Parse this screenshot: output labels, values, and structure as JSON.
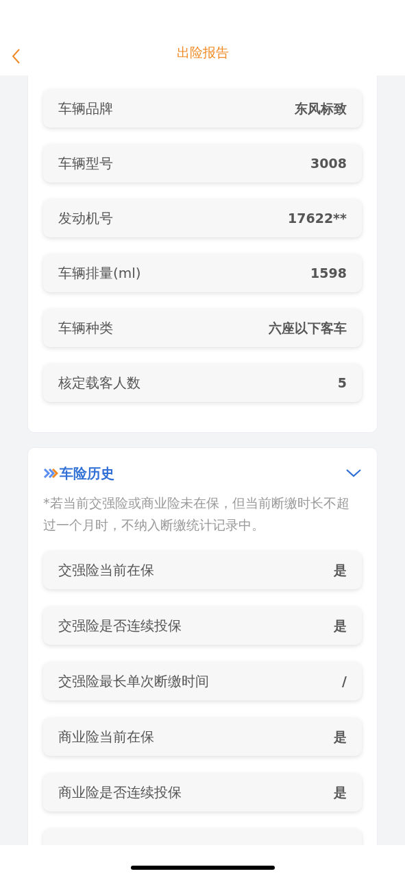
{
  "header": {
    "title": "出险报告"
  },
  "vehicle_rows": [
    {
      "label": "车辆品牌",
      "value": "东风标致"
    },
    {
      "label": "车辆型号",
      "value": "3008"
    },
    {
      "label": "发动机号",
      "value": "17622**"
    },
    {
      "label": "车辆排量(ml)",
      "value": "1598"
    },
    {
      "label": "车辆种类",
      "value": "六座以下客车"
    },
    {
      "label": "核定载客人数",
      "value": "5"
    }
  ],
  "history": {
    "title": "车险历史",
    "expanded": true,
    "note": "*若当前交强险或商业险未在保，但当前断缴时长不超过一个月时，不纳入断缴统计记录中。",
    "rows": [
      {
        "label": "交强险当前在保",
        "value": "是"
      },
      {
        "label": "交强险是否连续投保",
        "value": "是"
      },
      {
        "label": "交强险最长单次断缴时间",
        "value": "/"
      },
      {
        "label": "商业险当前在保",
        "value": "是"
      },
      {
        "label": "商业险是否连续投保",
        "value": "是"
      }
    ]
  }
}
